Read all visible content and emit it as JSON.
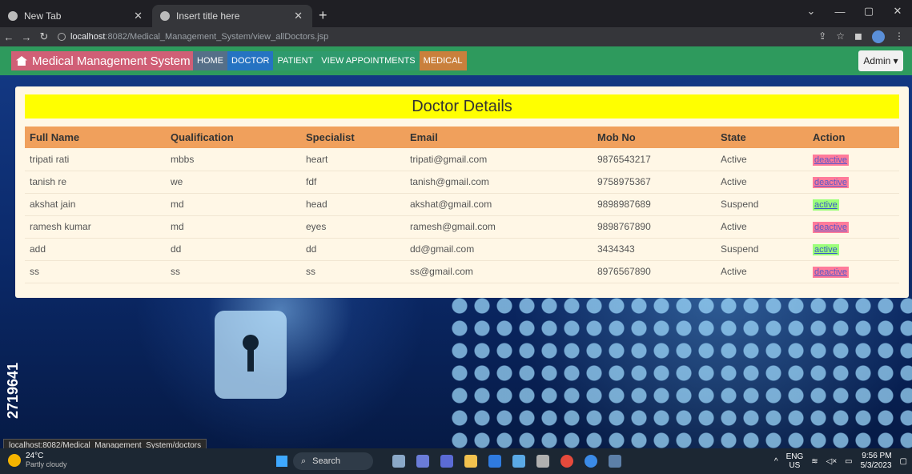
{
  "browser": {
    "tabs": [
      {
        "title": "New Tab"
      },
      {
        "title": "Insert title here"
      }
    ],
    "url_host": "localhost",
    "url_rest": ":8082/Medical_Management_System/view_allDoctors.jsp",
    "status_url": "localhost:8082/Medical_Management_System/doctors"
  },
  "navbar": {
    "brand": "Medical Management System",
    "links": [
      "HOME",
      "DOCTOR",
      "PATIENT",
      "VIEW APPOINTMENTS",
      "MEDICAL"
    ],
    "admin": "Admin ▾"
  },
  "card": {
    "title": "Doctor Details",
    "columns": [
      "Full Name",
      "Qualification",
      "Specialist",
      "Email",
      "Mob No",
      "State",
      "Action"
    ],
    "rows": [
      {
        "name": "tripati rati",
        "qual": "mbbs",
        "spec": "heart",
        "email": "tripati@gmail.com",
        "mob": "9876543217",
        "state": "Active",
        "action": "deactive"
      },
      {
        "name": "tanish re",
        "qual": "we",
        "spec": "fdf",
        "email": "tanish@gmail.com",
        "mob": "9758975367",
        "state": "Active",
        "action": "deactive"
      },
      {
        "name": "akshat jain",
        "qual": "md",
        "spec": "head",
        "email": "akshat@gmail.com",
        "mob": "9898987689",
        "state": "Suspend",
        "action": "active"
      },
      {
        "name": "ramesh kumar",
        "qual": "md",
        "spec": "eyes",
        "email": "ramesh@gmail.com",
        "mob": "9898767890",
        "state": "Active",
        "action": "deactive"
      },
      {
        "name": "add",
        "qual": "dd",
        "spec": "dd",
        "email": "dd@gmail.com",
        "mob": "3434343",
        "state": "Suspend",
        "action": "active"
      },
      {
        "name": "ss",
        "qual": "ss",
        "spec": "ss",
        "email": "ss@gmail.com",
        "mob": "8976567890",
        "state": "Active",
        "action": "deactive"
      }
    ]
  },
  "background": {
    "watermark": "2719641"
  },
  "taskbar": {
    "temp": "24°C",
    "weather": "Partly cloudy",
    "search": "Search",
    "lang1": "ENG",
    "lang2": "US",
    "time": "9:56 PM",
    "date": "5/3/2023"
  }
}
